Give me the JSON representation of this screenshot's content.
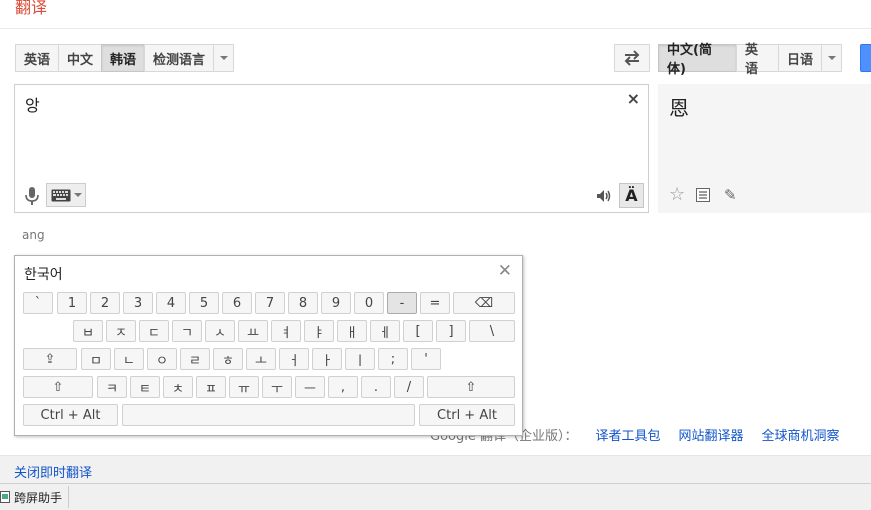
{
  "header": {
    "title": "翻译"
  },
  "source_languages": {
    "buttons": [
      "英语",
      "中文",
      "韩语",
      "检测语言"
    ],
    "selected_index": 2
  },
  "target_languages": {
    "buttons": [
      "中文(简体)",
      "英语",
      "日语"
    ],
    "selected_index": 0
  },
  "source": {
    "text": "앙",
    "clear_label": "×"
  },
  "accent_label": "Ä",
  "result": {
    "text": "恩",
    "star": "☆",
    "edit": "✎"
  },
  "romanization": "ang",
  "keyboard": {
    "title": "한국어",
    "close_label": "✕",
    "rows": [
      [
        "`",
        "1",
        "2",
        "3",
        "4",
        "5",
        "6",
        "7",
        "8",
        "9",
        "0",
        "-",
        "=",
        "⌫"
      ],
      [
        "ㅂ",
        "ㅈ",
        "ㄷ",
        "ㄱ",
        "ㅅ",
        "ㅛ",
        "ㅕ",
        "ㅑ",
        "ㅐ",
        "ㅔ",
        "[",
        "]",
        "\\"
      ],
      [
        "⇪",
        "ㅁ",
        "ㄴ",
        "ㅇ",
        "ㄹ",
        "ㅎ",
        "ㅗ",
        "ㅓ",
        "ㅏ",
        "ㅣ",
        ";",
        "'"
      ],
      [
        "⇧",
        "ㅋ",
        "ㅌ",
        "ㅊ",
        "ㅍ",
        "ㅠ",
        "ㅜ",
        "ㅡ",
        ",",
        ".",
        "/",
        "⇧"
      ],
      [
        "Ctrl + Alt",
        "",
        "Ctrl + Alt"
      ]
    ],
    "pressed_key": "-"
  },
  "footer": {
    "prefix": "Google 翻译（企业版）：",
    "links": [
      "译者工具包",
      "网站翻译器",
      "全球商机洞察"
    ],
    "toggle_instant": "关闭即时翻译"
  },
  "taskbar": {
    "item_label": "跨屏助手"
  }
}
